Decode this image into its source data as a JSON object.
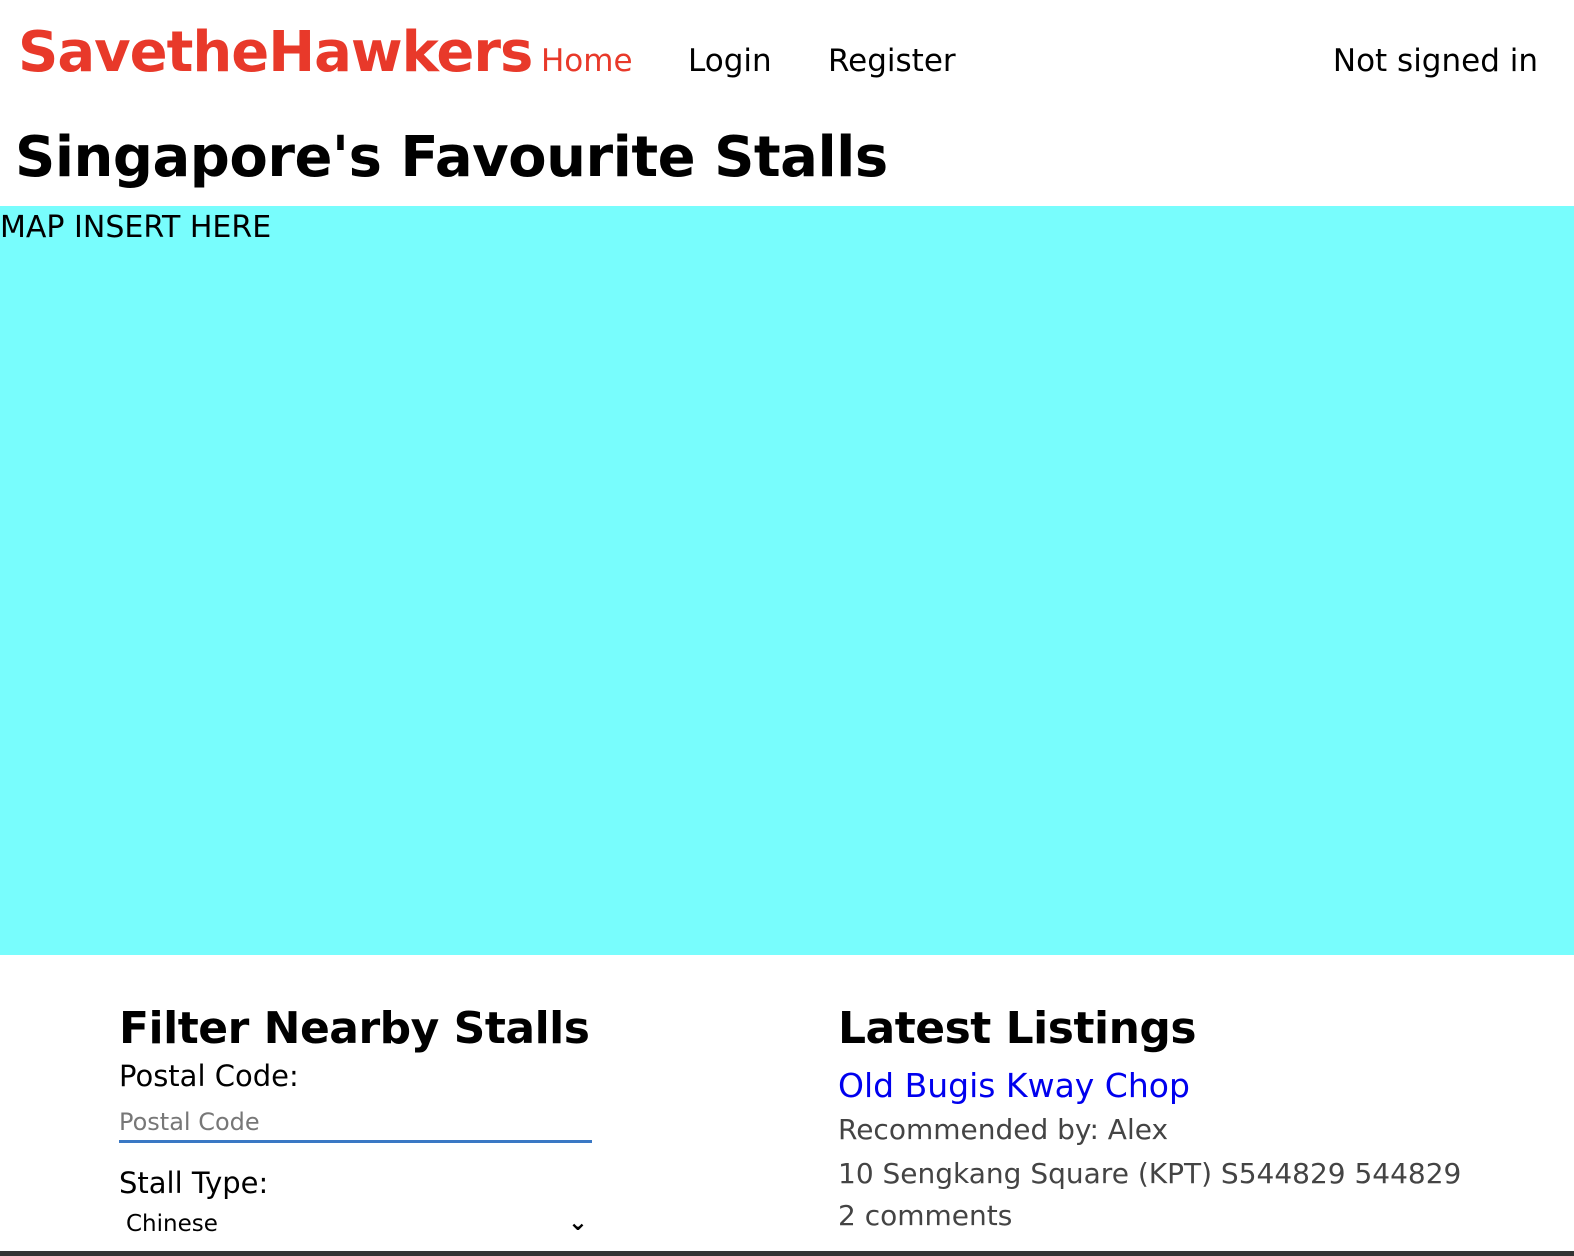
{
  "navbar": {
    "brand": "SavetheHawkers",
    "home": "Home",
    "login": "Login",
    "register": "Register",
    "status": "Not signed in"
  },
  "page": {
    "title": "Singapore's Favourite Stalls"
  },
  "map": {
    "label": "MAP INSERT HERE",
    "background": "#78fdfd"
  },
  "filter": {
    "heading": "Filter Nearby Stalls",
    "postal_label": "Postal Code:",
    "postal_placeholder": "Postal Code",
    "postal_value": "",
    "stall_type_label": "Stall Type:",
    "stall_type_selected": "Chinese"
  },
  "listings": {
    "heading": "Latest Listings",
    "items": [
      {
        "title": "Old Bugis Kway Chop",
        "recommended_by": "Recommended by: Alex",
        "address": "10 Sengkang Square (KPT) S544829 544829",
        "comments": "2 comments"
      }
    ]
  },
  "colors": {
    "brand": "#e8392a",
    "link": "#0000ee",
    "input_underline": "#3a78c4"
  }
}
